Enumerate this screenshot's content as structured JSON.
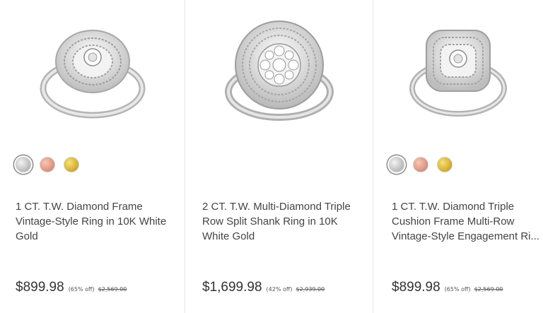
{
  "products": [
    {
      "title": "1 CT. T.W. Diamond Frame Vintage-Style Ring in 10K White Gold",
      "price": "$899.98",
      "discount": "(65% off)",
      "original_price": "$2,569.00",
      "ring_icon": "round-halo-ring-image",
      "swatches": [
        "white-gold",
        "rose-gold",
        "yellow-gold"
      ],
      "selected_swatch": "white-gold"
    },
    {
      "title": "2 CT. T.W. Multi-Diamond Triple Row Split Shank Ring in 10K White Gold",
      "price": "$1,699.98",
      "discount": "(42% off)",
      "original_price": "$2,939.00",
      "ring_icon": "round-cluster-ring-image",
      "swatches": []
    },
    {
      "title": "1 CT. T.W. Diamond Triple Cushion Frame Multi-Row Vintage-Style Engagement Ri...",
      "price": "$899.98",
      "discount": "(65% off)",
      "original_price": "$2,569.00",
      "ring_icon": "cushion-halo-ring-image",
      "swatches": [
        "white-gold",
        "rose-gold",
        "yellow-gold"
      ],
      "selected_swatch": "white-gold"
    }
  ],
  "colors": {
    "white_gold": "#c0c0c0",
    "rose_gold": "#d98f7b",
    "yellow_gold": "#d2a82a",
    "divider": "#e6e6e6"
  }
}
